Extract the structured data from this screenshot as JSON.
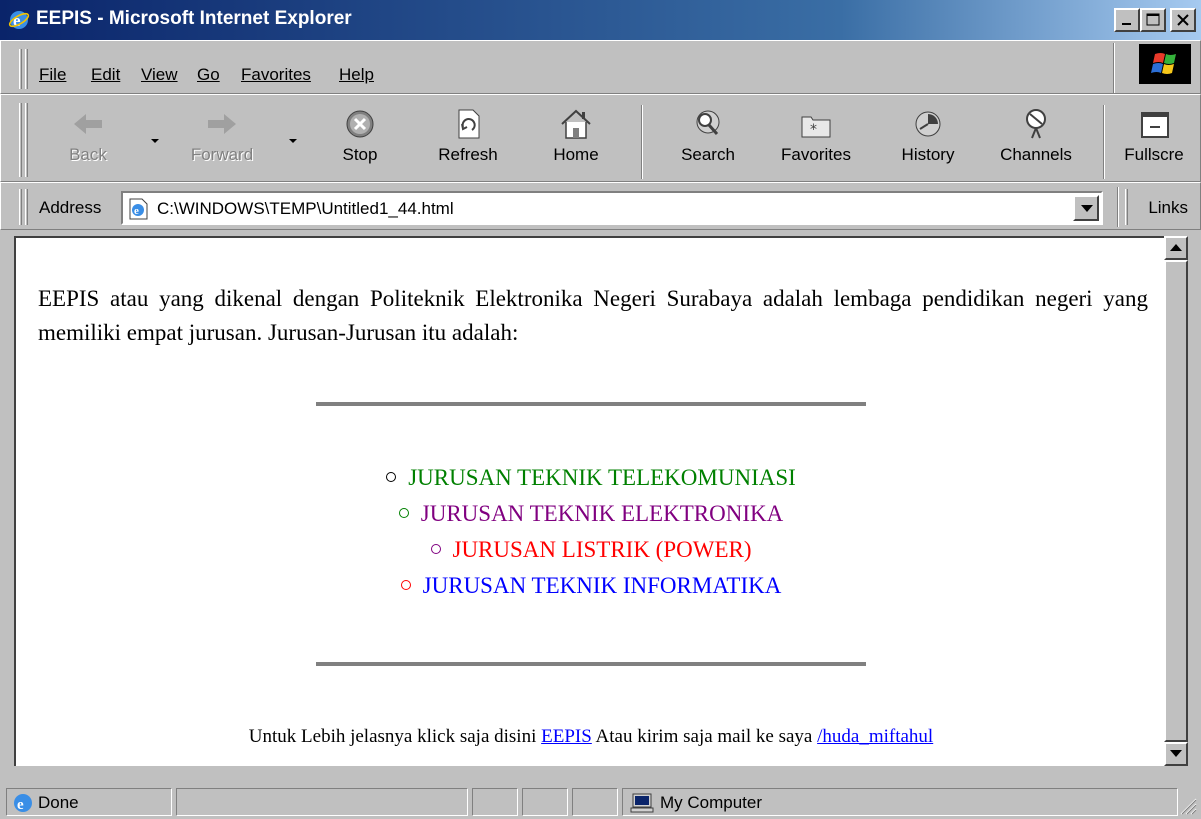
{
  "window": {
    "title": "EEPIS - Microsoft Internet Explorer"
  },
  "menu": [
    "File",
    "Edit",
    "View",
    "Go",
    "Favorites",
    "Help"
  ],
  "toolbar": {
    "back": "Back",
    "forward": "Forward",
    "stop": "Stop",
    "refresh": "Refresh",
    "home": "Home",
    "search": "Search",
    "favorites": "Favorites",
    "history": "History",
    "channels": "Channels",
    "fullscreen": "Fullscre"
  },
  "address": {
    "label": "Address",
    "url": "C:\\WINDOWS\\TEMP\\Untitled1_44.html",
    "links_label": "Links"
  },
  "content": {
    "intro": "EEPIS atau yang dikenal dengan Politeknik Elektronika Negeri Surabaya adalah lembaga pendidikan negeri yang memiliki empat jurusan. Jurusan-Jurusan itu adalah:",
    "departments": [
      {
        "label": "JURUSAN TEKNIK TELEKOMUNIASI",
        "color": "#008000",
        "bullet_color": "#000000"
      },
      {
        "label": "JURUSAN TEKNIK ELEKTRONIKA",
        "color": "#800080",
        "bullet_color": "#008000"
      },
      {
        "label": "JURUSAN LISTRIK (POWER)",
        "color": "#ff0000",
        "bullet_color": "#800080"
      },
      {
        "label": "JURUSAN TEKNIK INFORMATIKA",
        "color": "#0000ff",
        "bullet_color": "#ff0000"
      }
    ],
    "footer": {
      "text_before": "Untuk Lebih jelasnya klick saja disini ",
      "link1": "EEPIS",
      "text_middle": " Atau kirim saja mail ke saya ",
      "link2": "/huda_miftahul"
    }
  },
  "status": {
    "text": "Done",
    "zone": "My Computer"
  }
}
